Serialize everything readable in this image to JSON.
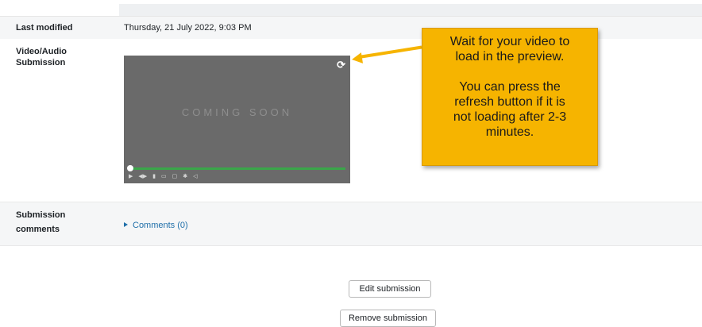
{
  "rows": {
    "last_modified": {
      "label": "Last modified",
      "value": "Thursday, 21 July 2022, 9:03 PM"
    },
    "video": {
      "label_line1": "Video/Audio",
      "label_line2": "Submission"
    },
    "comments": {
      "label_line1": "Submission",
      "label_line2": "comments",
      "link": "Comments (0)"
    }
  },
  "player": {
    "placeholder": "COMING SOON",
    "refresh_icon": "refresh-icon",
    "progress_fraction": 1.0,
    "controls": [
      "play-icon",
      "skip-icon",
      "volume-icon",
      "captions-icon",
      "fullscreen-icon",
      "settings-icon",
      "mute-icon"
    ]
  },
  "callout": {
    "line1": "Wait for your video to",
    "line2": "load in the preview.",
    "line3": "You can press the",
    "line4": "refresh button if it is",
    "line5": "not loading after 2-3",
    "line6": "minutes.",
    "color": "#f6b400"
  },
  "buttons": {
    "edit": "Edit submission",
    "remove": "Remove submission"
  }
}
